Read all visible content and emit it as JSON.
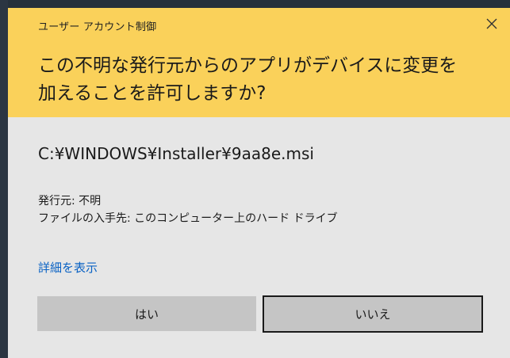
{
  "dialog": {
    "title": "ユーザー アカウント制御",
    "close_icon": "close-icon",
    "question_line1": "この不明な発行元からのアプリがデバイスに変更を",
    "question_line2": "加えることを許可しますか?",
    "program_path": "C:¥WINDOWS¥Installer¥9aa8e.msi",
    "publisher_line": "発行元: 不明",
    "origin_line": "ファイルの入手先: このコンピューター上のハード ドライブ",
    "details_link": "詳細を表示",
    "yes_label": "はい",
    "no_label": "いいえ"
  },
  "colors": {
    "header_bg": "#fad15a",
    "body_bg": "#e6e6e6",
    "link": "#0a62c4",
    "button_bg": "#c5c5c5"
  }
}
